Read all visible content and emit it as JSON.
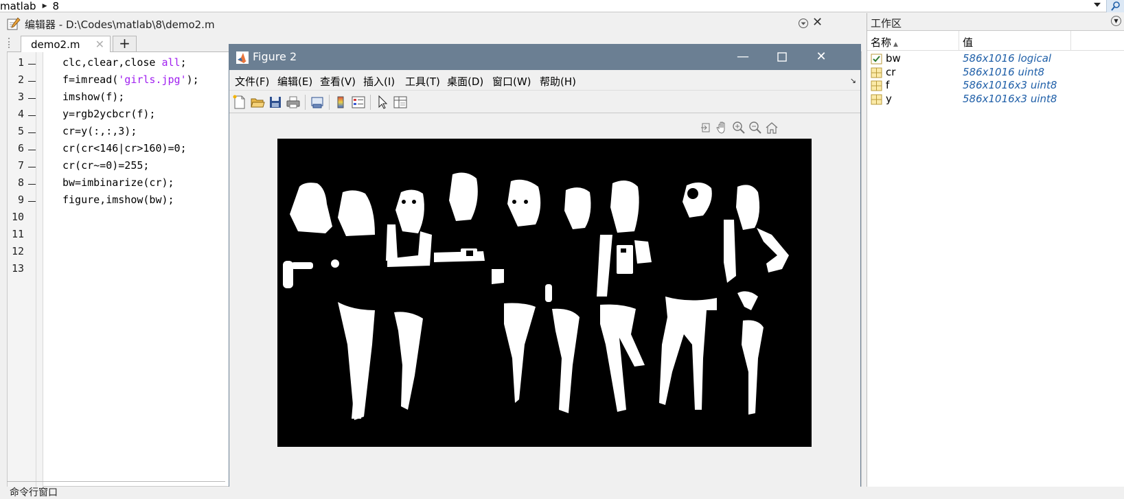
{
  "address_bar": {
    "path_prefix": "matlab",
    "path_last": "8"
  },
  "editor": {
    "title": "编辑器 - D:\\Codes\\matlab\\8\\demo2.m",
    "tab_label": "demo2.m",
    "tab_add": "+",
    "lines": [
      {
        "n": "1",
        "pre": "clc,clear,close ",
        "str": "all",
        "post": ";"
      },
      {
        "n": "2",
        "pre": "f=imread(",
        "str": "'girls.jpg'",
        "post": ");"
      },
      {
        "n": "3",
        "pre": "imshow(f);",
        "str": "",
        "post": ""
      },
      {
        "n": "4",
        "pre": "y=rgb2ycbcr(f);",
        "str": "",
        "post": ""
      },
      {
        "n": "5",
        "pre": "cr=y(:,:,3);",
        "str": "",
        "post": ""
      },
      {
        "n": "6",
        "pre": "cr(cr<146|cr>160)=0;",
        "str": "",
        "post": ""
      },
      {
        "n": "7",
        "pre": "cr(cr~=0)=255;",
        "str": "",
        "post": ""
      },
      {
        "n": "8",
        "pre": "bw=imbinarize(cr);",
        "str": "",
        "post": ""
      },
      {
        "n": "9",
        "pre": "figure,imshow(bw);",
        "str": "",
        "post": ""
      },
      {
        "n": "10",
        "pre": "",
        "str": "",
        "post": ""
      },
      {
        "n": "11",
        "pre": "",
        "str": "",
        "post": ""
      },
      {
        "n": "12",
        "pre": "",
        "str": "",
        "post": ""
      },
      {
        "n": "13",
        "pre": "",
        "str": "",
        "post": ""
      }
    ],
    "command_window_label": "命令行窗口"
  },
  "workspace": {
    "title": "工作区",
    "col_name": "名称",
    "col_value": "值",
    "vars": [
      {
        "name": "bw",
        "value": "586x1016 logical",
        "icon": "logical-check-icon"
      },
      {
        "name": "cr",
        "value": "586x1016 uint8",
        "icon": "matrix-grid-icon"
      },
      {
        "name": "f",
        "value": "586x1016x3 uint8",
        "icon": "matrix-grid-icon"
      },
      {
        "name": "y",
        "value": "586x1016x3 uint8",
        "icon": "matrix-grid-icon"
      }
    ]
  },
  "figure": {
    "title": "Figure 2",
    "menu": [
      "文件(F)",
      "编辑(E)",
      "查看(V)",
      "插入(I)",
      "工具(T)",
      "桌面(D)",
      "窗口(W)",
      "帮助(H)"
    ],
    "colors": {
      "titlebar": "#6b7f93",
      "axes_bg": "#000000",
      "foreground": "#ffffff"
    }
  },
  "colors": {
    "string": "#a020f0",
    "workspace_value": "#1f5fa8"
  }
}
